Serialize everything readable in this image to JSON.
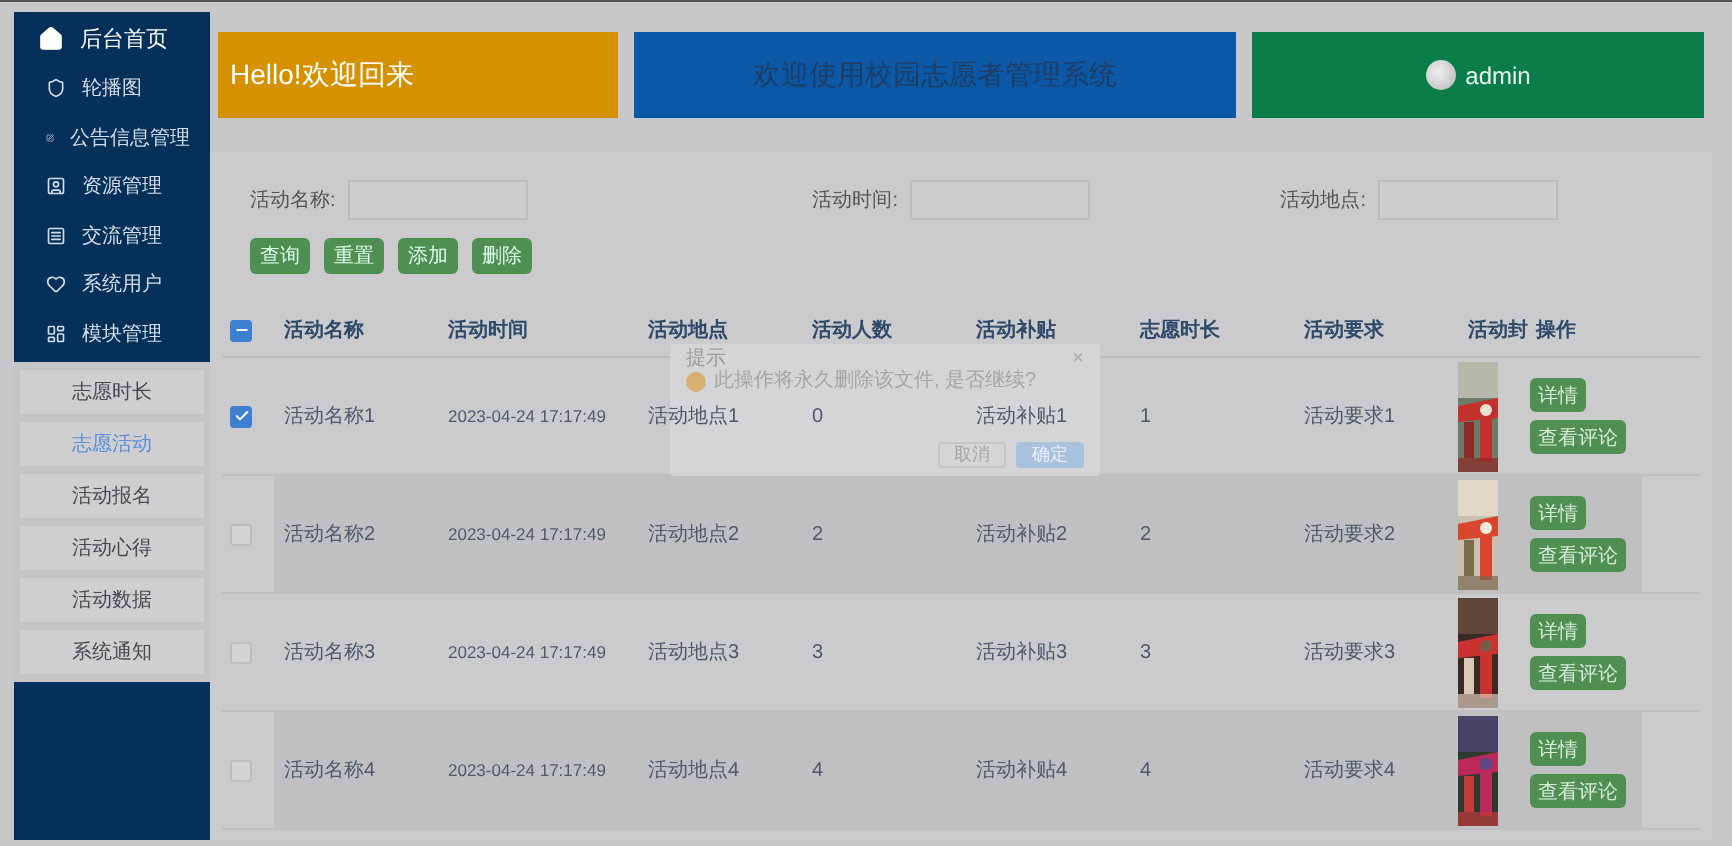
{
  "sidebar": {
    "home": "后台首页",
    "menu": [
      "轮播图",
      "公告信息管理",
      "资源管理",
      "交流管理",
      "系统用户",
      "模块管理"
    ],
    "submenu": [
      {
        "label": "志愿时长",
        "selected": false
      },
      {
        "label": "志愿活动",
        "selected": true
      },
      {
        "label": "活动报名",
        "selected": false
      },
      {
        "label": "活动心得",
        "selected": false
      },
      {
        "label": "活动数据",
        "selected": false
      },
      {
        "label": "系统通知",
        "selected": false
      }
    ]
  },
  "header": {
    "greeting": "Hello!欢迎回来",
    "title": "欢迎使用校园志愿者管理系统",
    "user": "admin"
  },
  "search": {
    "fields": [
      "活动名称:",
      "活动时间:",
      "活动地点:"
    ],
    "buttons": [
      "查询",
      "重置",
      "添加",
      "删除"
    ]
  },
  "table": {
    "select_all_partial": true,
    "columns": [
      "活动名称",
      "活动时间",
      "活动地点",
      "活动人数",
      "活动补贴",
      "志愿时长",
      "活动要求",
      "活动封",
      "操作"
    ],
    "rows": [
      {
        "selected": true,
        "cells": [
          "活动名称1",
          "2023-04-24 17:17:49",
          "活动地点1",
          "0",
          "活动补贴1",
          "1",
          "活动要求1"
        ],
        "actions": [
          "详情",
          "查看评论"
        ]
      },
      {
        "selected": false,
        "cells": [
          "活动名称2",
          "2023-04-24 17:17:49",
          "活动地点2",
          "2",
          "活动补贴2",
          "2",
          "活动要求2"
        ],
        "actions": [
          "详情",
          "查看评论"
        ]
      },
      {
        "selected": false,
        "cells": [
          "活动名称3",
          "2023-04-24 17:17:49",
          "活动地点3",
          "3",
          "活动补贴3",
          "3",
          "活动要求3"
        ],
        "actions": [
          "详情",
          "查看评论"
        ]
      },
      {
        "selected": false,
        "cells": [
          "活动名称4",
          "2023-04-24 17:17:49",
          "活动地点4",
          "4",
          "活动补贴4",
          "4",
          "活动要求4"
        ],
        "actions": [
          "详情",
          "查看评论"
        ]
      }
    ]
  },
  "dialog": {
    "title": "提示",
    "close": "×",
    "message": "此操作将永久删除该文件, 是否继续?",
    "buttons": [
      "取消",
      "确定"
    ]
  }
}
